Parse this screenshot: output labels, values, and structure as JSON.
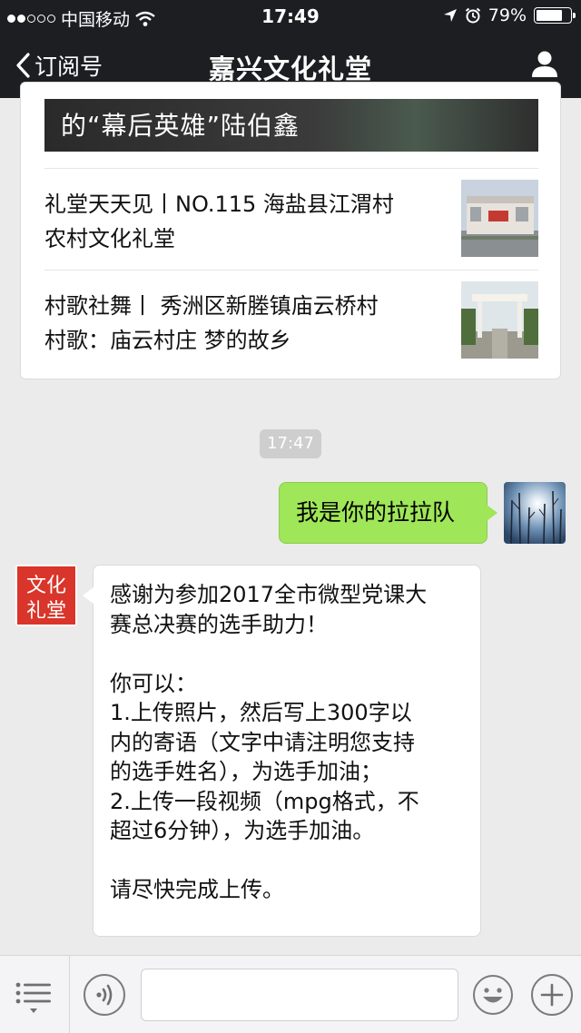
{
  "status_bar": {
    "carrier": "中国移动",
    "time": "17:49",
    "battery": "79%",
    "battery_level": 0.79,
    "icons": [
      "signal-icon",
      "wifi-icon",
      "location-arrow-icon",
      "alarm-icon",
      "battery-icon"
    ]
  },
  "nav": {
    "back_label": "订阅号",
    "title": "嘉兴文化礼堂",
    "icons": [
      "chevron-left-icon",
      "profile-icon"
    ]
  },
  "article_card": {
    "cover_title": "的“幕后英雄”陆伯鑫",
    "items": [
      {
        "line1": "礼堂天天见丨NO.115 海盐县江渭村",
        "line2": "农村文化礼堂",
        "thumb": "building-photo"
      },
      {
        "line1": "村歌社舞丨 秀洲区新塍镇庙云桥村",
        "line2": "村歌：庙云村庄 梦的故乡",
        "thumb": "archway-photo"
      }
    ]
  },
  "chat": {
    "timestamp": "17:47",
    "outgoing_text": "我是你的拉拉队",
    "incoming_lines": [
      "感谢为参加2017全市微型党课大",
      "赛总决赛的选手助力！",
      "",
      "你可以：",
      "1.上传照片，然后写上300字以",
      "内的寄语（文字中请注明您支持",
      "的选手姓名），为选手加油；",
      "2.上传一段视频（mpg格式，不",
      "超过6分钟），为选手加油。",
      "",
      "请尽快完成上传。"
    ],
    "sender_avatar_text": "文化礼堂"
  },
  "input_bar": {
    "icons": [
      "menu-list-icon",
      "voice-icon",
      "emoji-icon",
      "plus-icon"
    ]
  },
  "colors": {
    "bar": "#1d1e22",
    "chat_bg": "#ebebeb",
    "outgoing_bubble": "#9fe658",
    "timestamp_bg": "#cecece",
    "logo_red": "#d9352a"
  }
}
